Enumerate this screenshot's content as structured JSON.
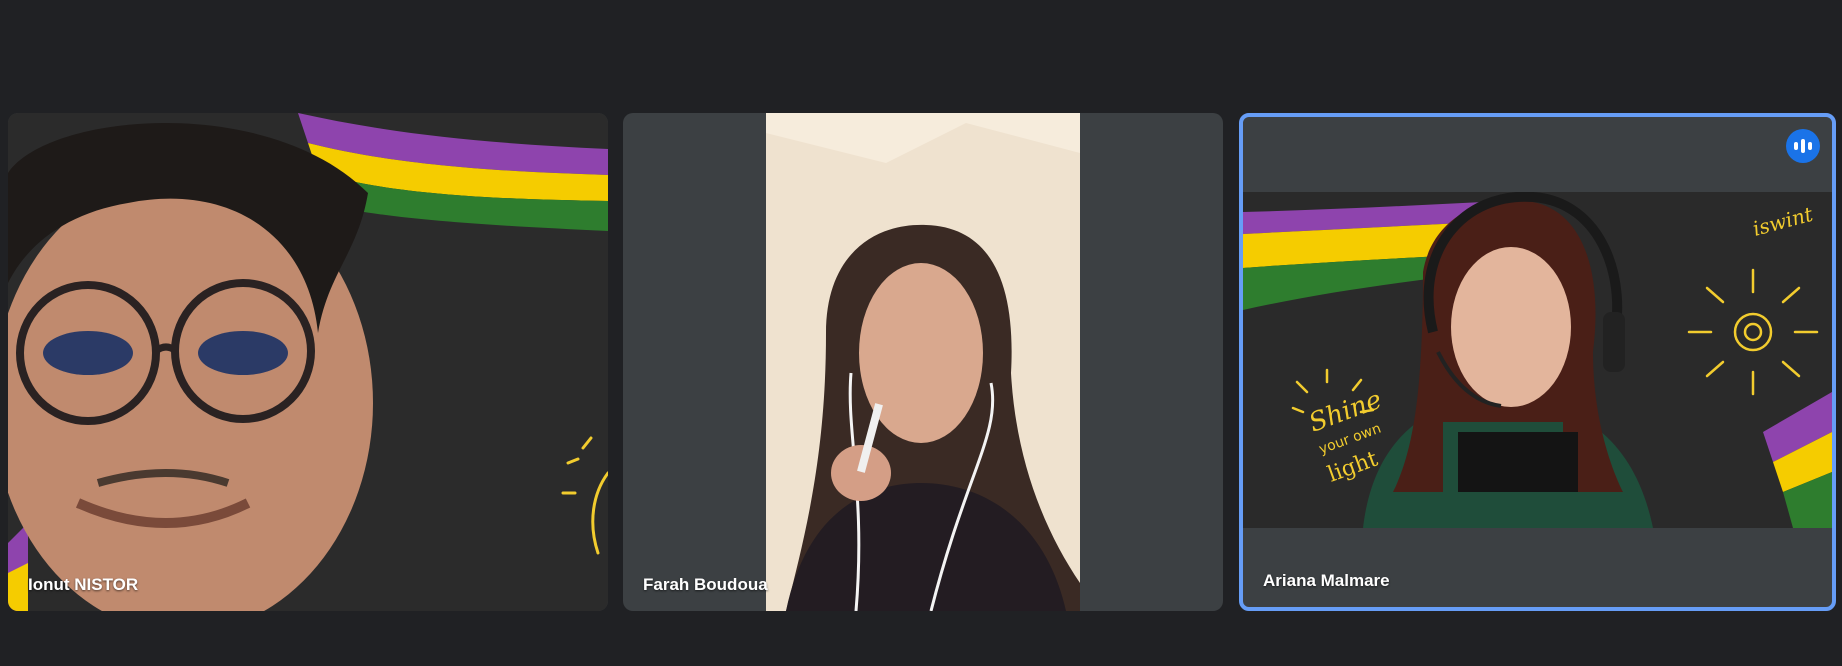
{
  "participants": [
    {
      "name": "Ionut NISTOR"
    },
    {
      "name": "Farah Boudoua"
    },
    {
      "name": "Ariana Malmare"
    }
  ],
  "background_text": {
    "shine": "Shine",
    "your_own": "your own",
    "light": "light",
    "logo": "iswint"
  },
  "indicators": {
    "speaking_icon": "audio-level-icon"
  },
  "colors": {
    "page_bg": "#202124",
    "tile_bg": "#3c4043",
    "active_border": "#669df6",
    "speaking_badge": "#1a73e8",
    "stripe_purple": "#8e44ad",
    "stripe_yellow": "#f5cc00",
    "stripe_green": "#2e7d2e",
    "chalk_yellow": "#f2cc2e"
  }
}
